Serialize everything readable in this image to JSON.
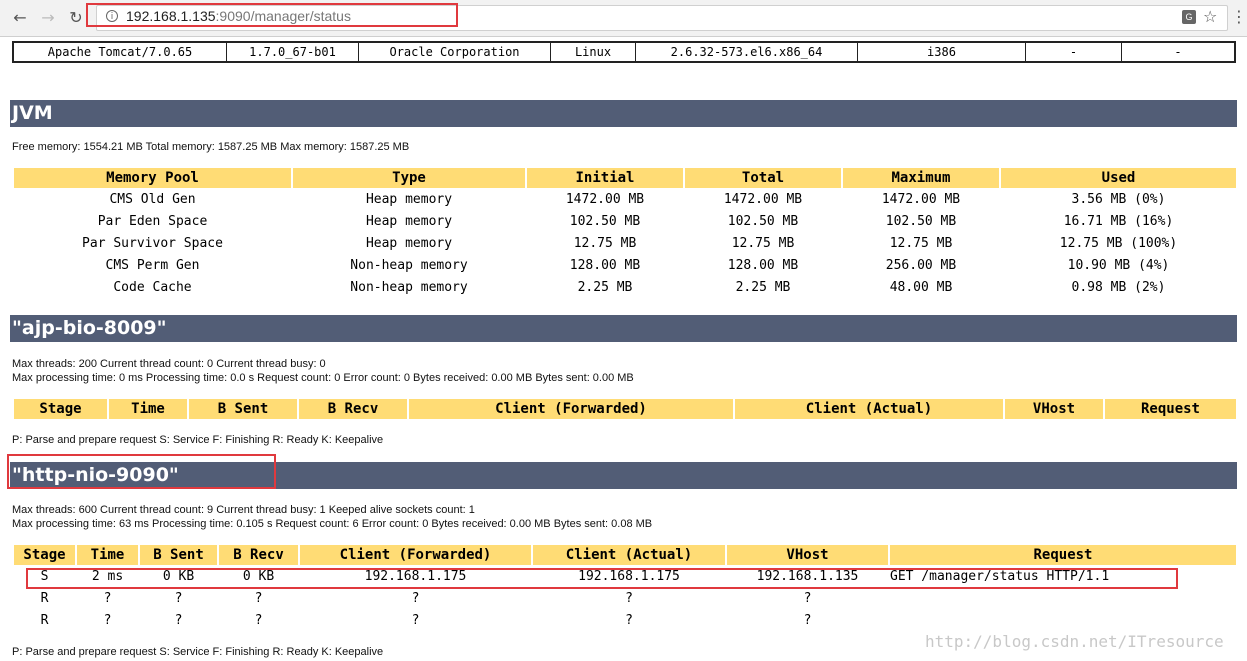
{
  "browser": {
    "url_host": "192.168.1.135",
    "url_path": ":9090/manager/status",
    "icons": {
      "back": "back-arrow-icon",
      "forward": "forward-arrow-icon",
      "reload": "reload-icon",
      "info": "info-icon",
      "translate": "translate-icon",
      "star": "star-icon"
    }
  },
  "server_info": [
    "Apache Tomcat/7.0.65",
    "1.7.0_67-b01",
    "Oracle Corporation",
    "Linux",
    "2.6.32-573.el6.x86_64",
    "i386",
    "-",
    "-"
  ],
  "jvm": {
    "title": "JVM",
    "summary": "Free memory: 1554.21 MB Total memory: 1587.25 MB Max memory: 1587.25 MB",
    "headers": [
      "Memory Pool",
      "Type",
      "Initial",
      "Total",
      "Maximum",
      "Used"
    ],
    "rows": [
      [
        "CMS Old Gen",
        "Heap memory",
        "1472.00 MB",
        "1472.00 MB",
        "1472.00 MB",
        "3.56 MB (0%)"
      ],
      [
        "Par Eden Space",
        "Heap memory",
        "102.50 MB",
        "102.50 MB",
        "102.50 MB",
        "16.71 MB (16%)"
      ],
      [
        "Par Survivor Space",
        "Heap memory",
        "12.75 MB",
        "12.75 MB",
        "12.75 MB",
        "12.75 MB (100%)"
      ],
      [
        "CMS Perm Gen",
        "Non-heap memory",
        "128.00 MB",
        "128.00 MB",
        "256.00 MB",
        "10.90 MB (4%)"
      ],
      [
        "Code Cache",
        "Non-heap memory",
        "2.25 MB",
        "2.25 MB",
        "48.00 MB",
        "0.98 MB (2%)"
      ]
    ]
  },
  "ajp": {
    "title": "\"ajp-bio-8009\"",
    "line1": "Max threads: 200 Current thread count: 0 Current thread busy: 0",
    "line2": "Max processing time: 0 ms Processing time: 0.0 s Request count: 0 Error count: 0 Bytes received: 0.00 MB Bytes sent: 0.00 MB",
    "headers": [
      "Stage",
      "Time",
      "B Sent",
      "B Recv",
      "Client (Forwarded)",
      "Client (Actual)",
      "VHost",
      "Request"
    ],
    "legend": "P: Parse and prepare request S: Service F: Finishing R: Ready K: Keepalive"
  },
  "http": {
    "title": "\"http-nio-9090\"",
    "line1": "Max threads: 600 Current thread count: 9 Current thread busy: 1 Keeped alive sockets count: 1",
    "line2": "Max processing time: 63 ms Processing time: 0.105 s Request count: 6 Error count: 0 Bytes received: 0.00 MB Bytes sent: 0.08 MB",
    "headers": [
      "Stage",
      "Time",
      "B Sent",
      "B Recv",
      "Client (Forwarded)",
      "Client (Actual)",
      "VHost",
      "Request"
    ],
    "rows": [
      [
        "S",
        "2 ms",
        "0 KB",
        "0 KB",
        "192.168.1.175",
        "192.168.1.175",
        "192.168.1.135",
        "GET /manager/status HTTP/1.1"
      ],
      [
        "R",
        "?",
        "?",
        "?",
        "?",
        "?",
        "?",
        ""
      ],
      [
        "R",
        "?",
        "?",
        "?",
        "?",
        "?",
        "?",
        ""
      ]
    ],
    "legend": "P: Parse and prepare request S: Service F: Finishing R: Ready K: Keepalive"
  },
  "watermark": "http://blog.csdn.net/ITresource"
}
